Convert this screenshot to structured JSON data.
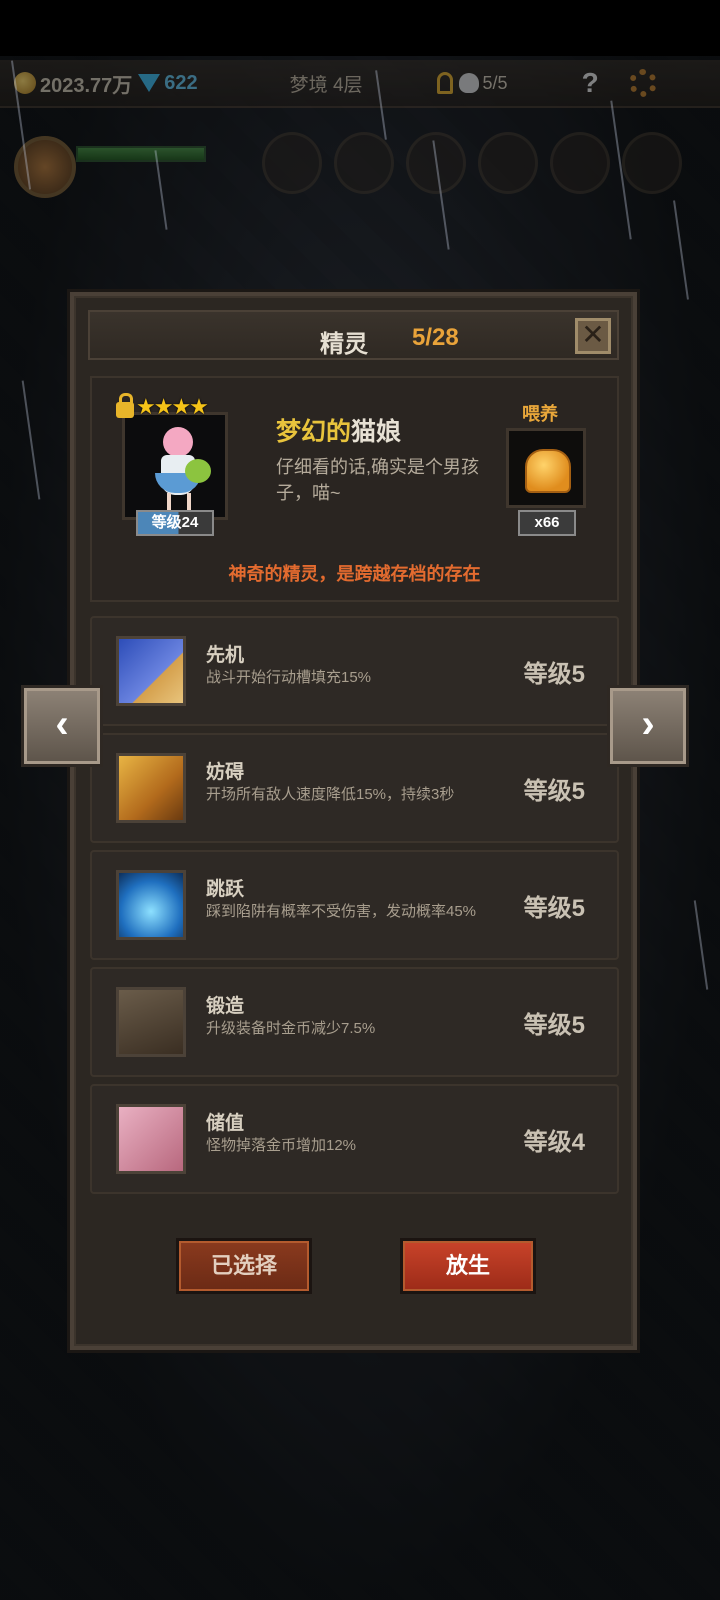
{
  "hud": {
    "gold": "2023.77万",
    "gems": "622",
    "floor": "梦境 4层",
    "kills": "5/5",
    "help_glyph": "?"
  },
  "panel": {
    "title": "精灵",
    "count": "5/28",
    "close_glyph": "✕"
  },
  "pet": {
    "stars": "★★★★",
    "level_label": "等级24",
    "name_highlight": "梦幻的",
    "name_rest": "猫娘",
    "description": "仔细看的话,确实是个男孩子，喵~",
    "feed_label": "喂养",
    "feed_count": "x66",
    "tagline": "神奇的精灵，是跨越存档的存在"
  },
  "skills": [
    {
      "name": "先机",
      "desc": "战斗开始行动槽填充15%",
      "level": "等级5",
      "icon": "cheetah-icon"
    },
    {
      "name": "妨碍",
      "desc": "开场所有敌人速度降低15%，持续3秒",
      "level": "等级5",
      "icon": "chained-boot-icon"
    },
    {
      "name": "跳跃",
      "desc": "踩到陷阱有概率不受伤害，发动概率45%",
      "level": "等级5",
      "icon": "jump-whirl-icon"
    },
    {
      "name": "锻造",
      "desc": "升级装备时金币减少7.5%",
      "level": "等级5",
      "icon": "hammer-icon"
    },
    {
      "name": "储值",
      "desc": "怪物掉落金币增加12%",
      "level": "等级4",
      "icon": "goblet-icon"
    }
  ],
  "nav": {
    "prev_glyph": "‹",
    "next_glyph": "›"
  },
  "buttons": {
    "selected_label": "已选择",
    "release_label": "放生"
  }
}
